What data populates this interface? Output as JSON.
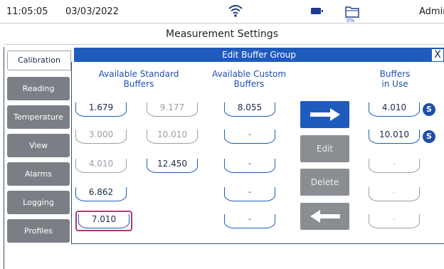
{
  "status": {
    "time": "11:05:05",
    "date": "03/03/2022",
    "storage": "0%",
    "user": "Admin"
  },
  "page": {
    "title": "Measurement Settings"
  },
  "sidebar": {
    "items": [
      {
        "label": "Calibration"
      },
      {
        "label": "Reading"
      },
      {
        "label": "Temperature"
      },
      {
        "label": "View"
      },
      {
        "label": "Alarms"
      },
      {
        "label": "Logging"
      },
      {
        "label": "Profiles"
      }
    ]
  },
  "panel": {
    "title": "Edit Buffer Group",
    "close": "X"
  },
  "columns": {
    "standard": [
      "Available Standard",
      "Buffers"
    ],
    "custom": [
      "Available Custom",
      "Buffers"
    ],
    "inuse": [
      "Buffers",
      "in Use"
    ]
  },
  "standard_buffers": [
    "1.679",
    "9.177",
    "3.000",
    "10.010",
    "4.010",
    "12.450",
    "6.862",
    "7.010"
  ],
  "custom_buffers": [
    "8.055",
    "-",
    "-",
    "-",
    "-"
  ],
  "inuse_buffers": [
    "4.010",
    "10.010",
    "-",
    "-",
    "-"
  ],
  "badges": [
    "S",
    "S"
  ],
  "actions": {
    "edit": "Edit",
    "delete": "Delete"
  },
  "colors": {
    "accent": "#1f5bbd",
    "sidebar": "#7b7f85",
    "selection": "#b03a72"
  }
}
